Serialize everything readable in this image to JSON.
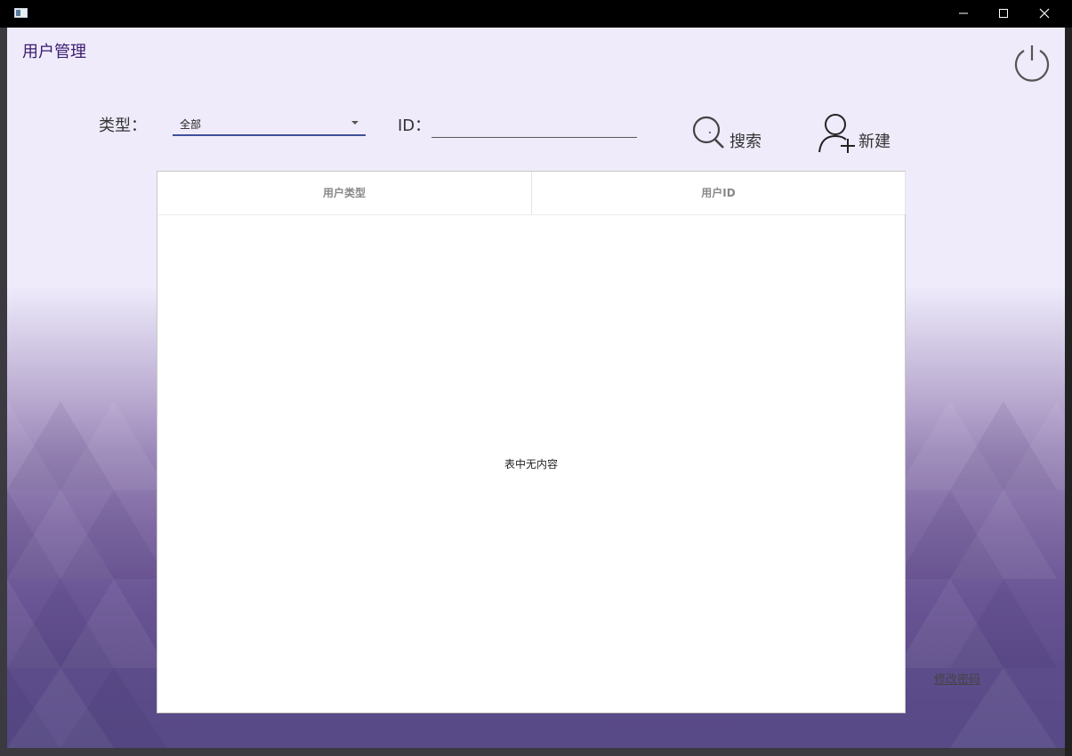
{
  "window": {
    "icons": {
      "app": "app-icon",
      "minimize": "minimize-icon",
      "maximize": "maximize-icon",
      "close": "close-icon"
    }
  },
  "header": {
    "title": "用户管理",
    "power_icon": "power-icon"
  },
  "filters": {
    "type_label": "类型：",
    "type_value": "全部",
    "id_label": "ID：",
    "id_value": "",
    "search_label": "搜索",
    "search_icon": "search-icon",
    "new_label": "新建",
    "new_icon": "add-user-icon"
  },
  "table": {
    "columns": [
      "用户类型",
      "用户ID"
    ],
    "rows": [],
    "empty_message": "表中无内容"
  },
  "footer": {
    "change_password_label": "修改密码"
  },
  "colors": {
    "title": "#3a1a6e",
    "select_underline": "#3f4f9b",
    "background_top": "#efebfb",
    "background_bottom": "#574a86"
  }
}
